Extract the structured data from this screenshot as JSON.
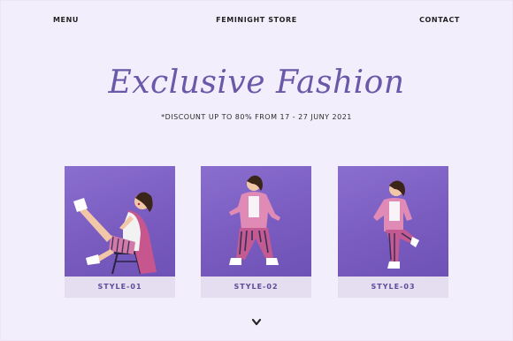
{
  "header": {
    "menu_label": "MENU",
    "brand": "FEMINIGHT STORE",
    "contact_label": "CONTACT"
  },
  "hero": {
    "title": "Exclusive Fashion",
    "subtitle": "*DISCOUNT UP TO 80% FROM 17 - 27 JUNY 2021"
  },
  "styles": [
    {
      "label": "STYLE-01"
    },
    {
      "label": "STYLE-02"
    },
    {
      "label": "STYLE-03"
    }
  ],
  "scroll": {
    "icon": "chevron-down-icon"
  },
  "colors": {
    "background": "#f3eefb",
    "accent": "#6a58a8",
    "card_background": "#7a5cc0",
    "label_background": "#e4def0"
  }
}
